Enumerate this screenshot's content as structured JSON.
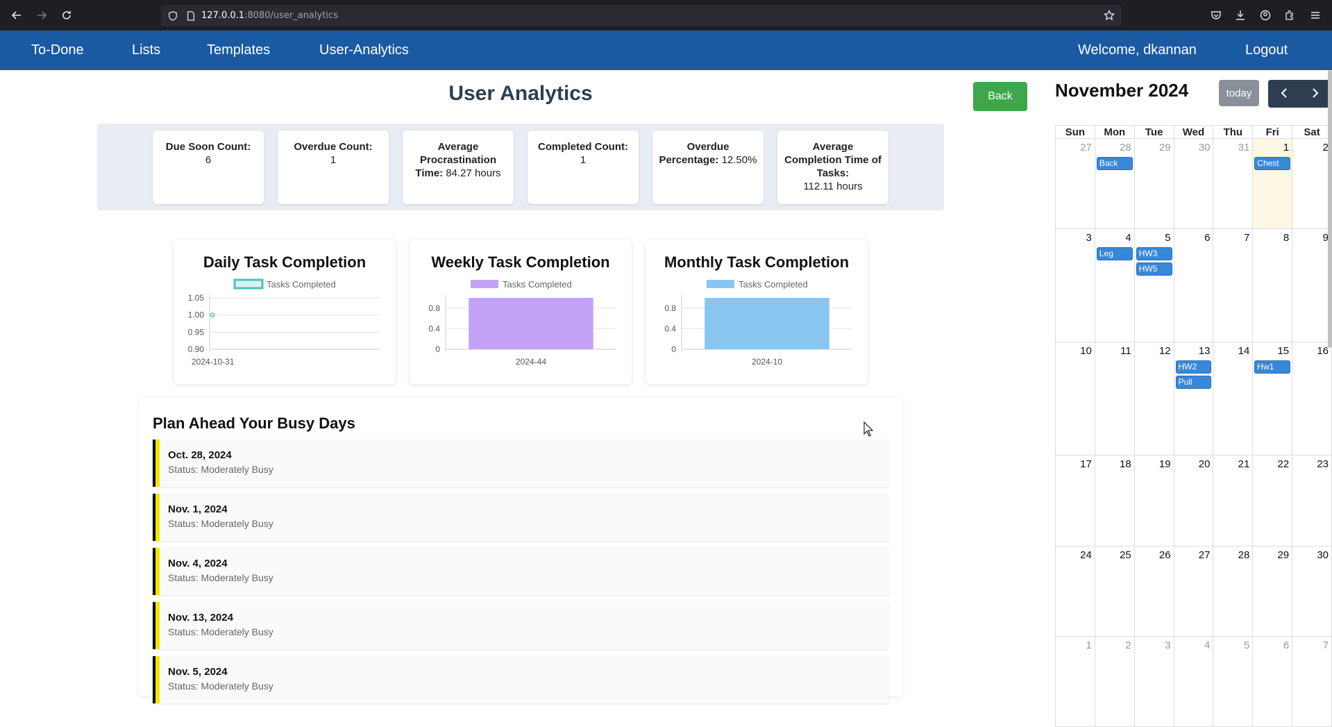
{
  "browser": {
    "url_host": "127.0.0.1",
    "url_rest": ":8080/user_analytics"
  },
  "nav": {
    "brand": "To-Done",
    "lists": "Lists",
    "templates": "Templates",
    "analytics": "User-Analytics",
    "welcome": "Welcome, dkannan",
    "logout": "Logout"
  },
  "page": {
    "title": "User Analytics",
    "back": "Back"
  },
  "stats": [
    {
      "label": "Due Soon Count:",
      "value": "6"
    },
    {
      "label": "Overdue Count:",
      "value": "1"
    },
    {
      "label": "Average Procrastination Time:",
      "value": "84.27 hours"
    },
    {
      "label": "Completed Count:",
      "value": "1"
    },
    {
      "label": "Overdue Percentage:",
      "value": "12.50%"
    },
    {
      "label": "Average Completion Time of Tasks:",
      "value": "112.11 hours"
    }
  ],
  "chart_data": [
    {
      "type": "line",
      "title": "Daily Task Completion",
      "legend": "Tasks Completed",
      "categories": [
        "2024-10-31"
      ],
      "values": [
        1
      ],
      "yticks": [
        "1.05",
        "1.00",
        "0.95",
        "0.90"
      ],
      "ylim": [
        0.9,
        1.05
      ],
      "color": "#4bc0c0"
    },
    {
      "type": "bar",
      "title": "Weekly Task Completion",
      "legend": "Tasks Completed",
      "categories": [
        "2024-44"
      ],
      "values": [
        1
      ],
      "yticks": [
        "0.8",
        "0.4",
        "0"
      ],
      "ylim": [
        0,
        1
      ],
      "color": "#c4a3f7"
    },
    {
      "type": "bar",
      "title": "Monthly Task Completion",
      "legend": "Tasks Completed",
      "categories": [
        "2024-10"
      ],
      "values": [
        1
      ],
      "yticks": [
        "0.8",
        "0.4",
        "0"
      ],
      "ylim": [
        0,
        1
      ],
      "color": "#8ac6f0"
    }
  ],
  "busy": {
    "title": "Plan Ahead Your Busy Days",
    "items": [
      {
        "date": "Oct. 28, 2024",
        "status": "Status: Moderately Busy"
      },
      {
        "date": "Nov. 1, 2024",
        "status": "Status: Moderately Busy"
      },
      {
        "date": "Nov. 4, 2024",
        "status": "Status: Moderately Busy"
      },
      {
        "date": "Nov. 13, 2024",
        "status": "Status: Moderately Busy"
      },
      {
        "date": "Nov. 5, 2024",
        "status": "Status: Moderately Busy"
      }
    ]
  },
  "calendar": {
    "title": "November 2024",
    "today_label": "today",
    "prev": "‹",
    "next": "›",
    "days_of_week": [
      "Sun",
      "Mon",
      "Tue",
      "Wed",
      "Thu",
      "Fri",
      "Sat"
    ],
    "weeks": [
      [
        {
          "n": "27",
          "o": true
        },
        {
          "n": "28",
          "o": true,
          "e": [
            "Back"
          ]
        },
        {
          "n": "29",
          "o": true
        },
        {
          "n": "30",
          "o": true
        },
        {
          "n": "31",
          "o": true
        },
        {
          "n": "1",
          "t": true,
          "e": [
            "Chest"
          ]
        },
        {
          "n": "2"
        }
      ],
      [
        {
          "n": "3"
        },
        {
          "n": "4",
          "e": [
            "Leg"
          ]
        },
        {
          "n": "5",
          "e": [
            "HW3",
            "HW5"
          ]
        },
        {
          "n": "6"
        },
        {
          "n": "7"
        },
        {
          "n": "8"
        },
        {
          "n": "9"
        }
      ],
      [
        {
          "n": "10"
        },
        {
          "n": "11"
        },
        {
          "n": "12"
        },
        {
          "n": "13",
          "e": [
            "HW2",
            "Pull"
          ]
        },
        {
          "n": "14"
        },
        {
          "n": "15",
          "e": [
            "Hw1"
          ]
        },
        {
          "n": "16"
        }
      ],
      [
        {
          "n": "17"
        },
        {
          "n": "18"
        },
        {
          "n": "19"
        },
        {
          "n": "20"
        },
        {
          "n": "21"
        },
        {
          "n": "22"
        },
        {
          "n": "23"
        }
      ],
      [
        {
          "n": "24"
        },
        {
          "n": "25"
        },
        {
          "n": "26"
        },
        {
          "n": "27"
        },
        {
          "n": "28"
        },
        {
          "n": "29"
        },
        {
          "n": "30"
        }
      ],
      [
        {
          "n": "1",
          "o": true
        },
        {
          "n": "2",
          "o": true
        },
        {
          "n": "3",
          "o": true
        },
        {
          "n": "4",
          "o": true
        },
        {
          "n": "5",
          "o": true
        },
        {
          "n": "6",
          "o": true
        },
        {
          "n": "7",
          "o": true
        }
      ]
    ]
  },
  "colors": {
    "navbar": "#1a5aa3",
    "back_button": "#3fa74a",
    "event": "#3788d8",
    "busy_marker": "#f5e400"
  }
}
